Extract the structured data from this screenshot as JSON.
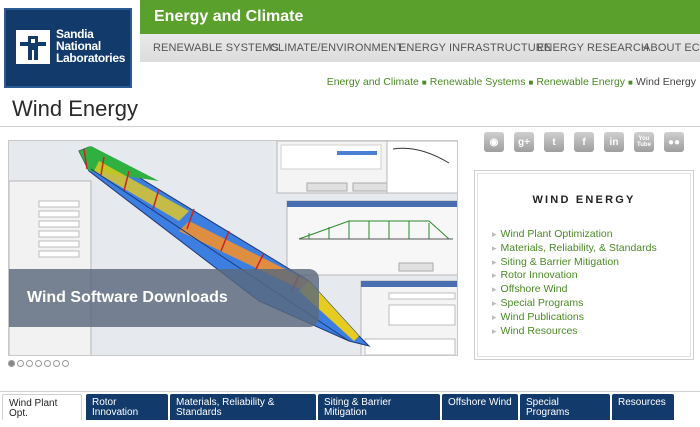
{
  "logo": {
    "lines": [
      "Sandia",
      "National",
      "Laboratories"
    ]
  },
  "header": {
    "section_title": "Energy and Climate",
    "nav": [
      "RENEWABLE SYSTEMS",
      "CLIMATE/ENVIRONMENT",
      "ENERGY INFRASTRUCTURE",
      "ENERGY RESEARCH",
      "ABOUT EC"
    ]
  },
  "breadcrumb": [
    "Energy and Climate",
    "Renewable Systems",
    "Renewable Energy",
    "Wind Energy"
  ],
  "page_title": "Wind Energy",
  "slideshow": {
    "caption": "Wind Software Downloads",
    "dot_count": 7,
    "active_dot": 0
  },
  "social": [
    {
      "icon": "rss-icon",
      "glyph": "◉"
    },
    {
      "icon": "google-plus-icon",
      "glyph": "g+"
    },
    {
      "icon": "twitter-icon",
      "glyph": "t"
    },
    {
      "icon": "facebook-icon",
      "glyph": "f"
    },
    {
      "icon": "linkedin-icon",
      "glyph": "in"
    },
    {
      "icon": "youtube-icon",
      "glyph": "You Tube"
    },
    {
      "icon": "flickr-icon",
      "glyph": "●●"
    }
  ],
  "sidebar": {
    "title": "WIND ENERGY",
    "links": [
      "Wind Plant Optimization",
      "Materials, Reliability, & Standards",
      "Siting & Barrier Mitigation",
      "Rotor Innovation",
      "Offshore Wind",
      "Special Programs",
      "Wind Publications",
      "Wind Resources"
    ]
  },
  "tabs": [
    "Wind Plant Opt.",
    "Rotor Innovation",
    "Materials, Reliability &\nStandards",
    "Siting & Barrier Mitigation",
    "Offshore Wind",
    "Special Programs",
    "Resources"
  ],
  "colors": {
    "green": "#5aa02c",
    "navy": "#123a6b",
    "link": "#4a8a24"
  }
}
